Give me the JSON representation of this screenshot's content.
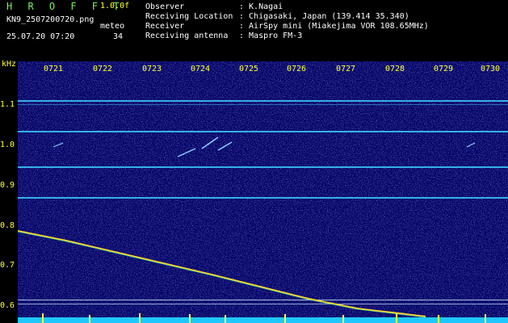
{
  "header": {
    "brand": "H R O F F T",
    "version": "1.0.0f",
    "filename": "KN9_2507200720.png",
    "meteo_label": "meteo",
    "datetime": "25.07.20 07:20",
    "count": "34",
    "info": [
      {
        "label": "Observer",
        "value": ": K.Nagai"
      },
      {
        "label": "Receiving Location",
        "value": ": Chigasaki, Japan (139.414 35.340)"
      },
      {
        "label": "Receiver",
        "value": ": AirSpy mini (Miakejima VOR 108.65MHz)"
      },
      {
        "label": "Receiving antenna",
        "value": ": Maspro FM-3"
      }
    ]
  },
  "axis": {
    "y_unit": "kHz",
    "y_ticks": [
      "1.1",
      "1.0",
      "0.9",
      "0.8",
      "0.7",
      "0.6"
    ],
    "x_ticks": [
      "0721",
      "0722",
      "0723",
      "0724",
      "0725",
      "0726",
      "0727",
      "0728",
      "0729",
      "0730"
    ]
  },
  "colors": {
    "background": "#06066a",
    "text_yellow": "#ffff33",
    "text_green": "#7cf05a",
    "line_cyan": "#3ecbff",
    "trace": "#ffd22e"
  }
}
